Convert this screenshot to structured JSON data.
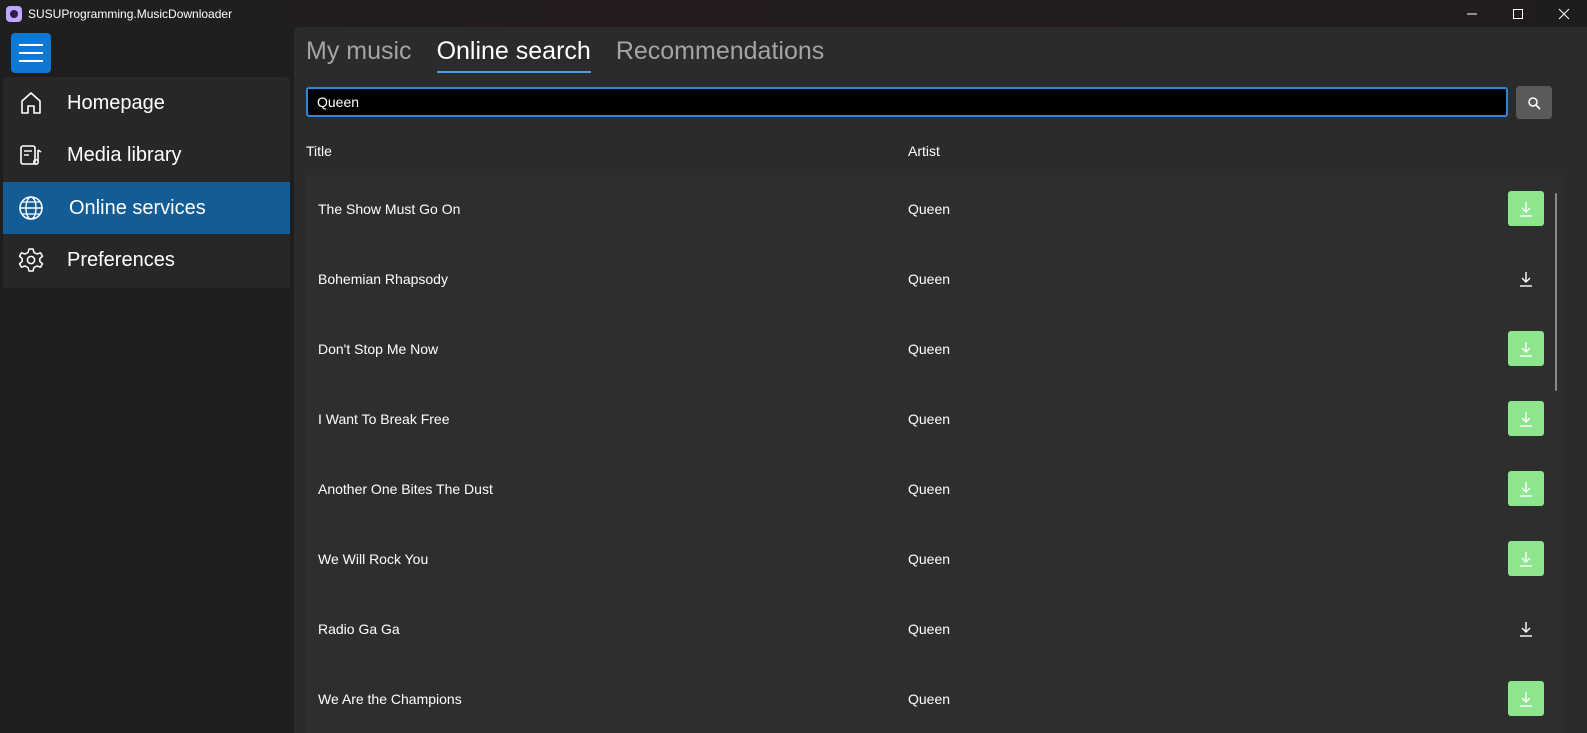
{
  "window": {
    "title": "SUSUProgramming.MusicDownloader"
  },
  "sidebar": {
    "items": [
      {
        "label": "Homepage",
        "icon": "home-icon"
      },
      {
        "label": "Media library",
        "icon": "media-library-icon"
      },
      {
        "label": "Online services",
        "icon": "globe-icon",
        "selected": true
      },
      {
        "label": "Preferences",
        "icon": "gear-icon"
      }
    ]
  },
  "tabs": [
    {
      "label": "My music"
    },
    {
      "label": "Online search",
      "active": true
    },
    {
      "label": "Recommendations"
    }
  ],
  "search": {
    "value": "Queen",
    "icon": "search-icon"
  },
  "table": {
    "columns": [
      "Title",
      "Artist"
    ],
    "rows": [
      {
        "title": "The Show Must Go On",
        "artist": "Queen",
        "download_state": "available"
      },
      {
        "title": "Bohemian Rhapsody",
        "artist": "Queen",
        "download_state": "plain"
      },
      {
        "title": "Don't Stop Me Now",
        "artist": "Queen",
        "download_state": "available"
      },
      {
        "title": "I Want To Break Free",
        "artist": "Queen",
        "download_state": "available"
      },
      {
        "title": "Another One Bites The Dust",
        "artist": "Queen",
        "download_state": "available"
      },
      {
        "title": "We Will Rock You",
        "artist": "Queen",
        "download_state": "available"
      },
      {
        "title": "Radio Ga Ga",
        "artist": "Queen",
        "download_state": "plain"
      },
      {
        "title": "We Are the Champions",
        "artist": "Queen",
        "download_state": "available"
      }
    ]
  },
  "colors": {
    "accent": "#0f78d4",
    "selected_nav": "#145c96",
    "download_green": "#8de58d"
  }
}
